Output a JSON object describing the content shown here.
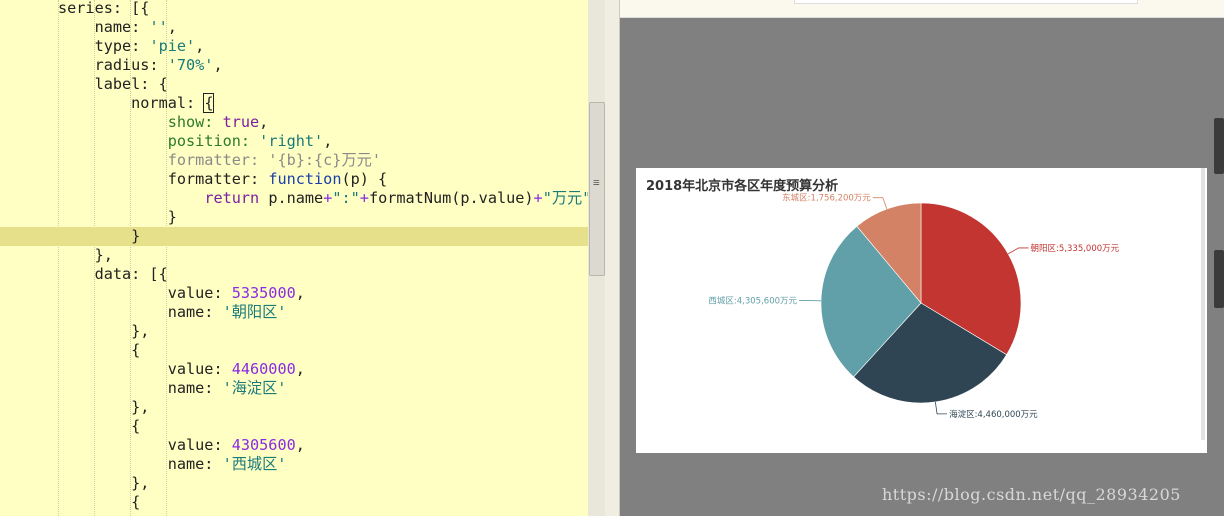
{
  "editor": {
    "lines": [
      [
        {
          "t": "series: [{",
          "c": "k"
        }
      ],
      [
        {
          "t": "    name: ",
          "c": "k"
        },
        {
          "t": "''",
          "c": "s"
        },
        {
          "t": ",",
          "c": "k"
        }
      ],
      [
        {
          "t": "    type: ",
          "c": "k"
        },
        {
          "t": "'pie'",
          "c": "s"
        },
        {
          "t": ",",
          "c": "k"
        }
      ],
      [
        {
          "t": "    radius: ",
          "c": "k"
        },
        {
          "t": "'70%'",
          "c": "s"
        },
        {
          "t": ",",
          "c": "k"
        }
      ],
      [
        {
          "t": "    label: {",
          "c": "k"
        }
      ],
      [
        {
          "t": "        normal: ",
          "c": "k"
        },
        {
          "t": "{",
          "c": "k cur"
        }
      ],
      [
        {
          "t": "            show: ",
          "c": "g"
        },
        {
          "t": "true",
          "c": "kw"
        },
        {
          "t": ",",
          "c": "k"
        }
      ],
      [
        {
          "t": "            position: ",
          "c": "g"
        },
        {
          "t": "'right'",
          "c": "s"
        },
        {
          "t": ",",
          "c": "k"
        }
      ],
      [
        {
          "t": "            formatter: '{b}:{c}万元'",
          "c": "cm"
        }
      ],
      [
        {
          "t": "            formatter: ",
          "c": "k"
        },
        {
          "t": "function",
          "c": "fn"
        },
        {
          "t": "(p) {",
          "c": "k"
        }
      ],
      [
        {
          "t": "                ",
          "c": "k"
        },
        {
          "t": "return",
          "c": "kw"
        },
        {
          "t": " p.name",
          "c": "k"
        },
        {
          "t": "+",
          "c": "op"
        },
        {
          "t": "\":\"",
          "c": "s"
        },
        {
          "t": "+",
          "c": "op"
        },
        {
          "t": "formatNum(p.value)",
          "c": "k"
        },
        {
          "t": "+",
          "c": "op"
        },
        {
          "t": "\"万元\"",
          "c": "s"
        },
        {
          "t": ";",
          "c": "k"
        }
      ],
      [
        {
          "t": "            }",
          "c": "k"
        }
      ],
      [
        {
          "t": "        }",
          "c": "k"
        }
      ],
      [
        {
          "t": "    },",
          "c": "k"
        }
      ],
      [
        {
          "t": "    data: [{",
          "c": "k"
        }
      ],
      [
        {
          "t": "            value: ",
          "c": "k"
        },
        {
          "t": "5335000",
          "c": "n"
        },
        {
          "t": ",",
          "c": "k"
        }
      ],
      [
        {
          "t": "            name: ",
          "c": "k"
        },
        {
          "t": "'朝阳区'",
          "c": "s"
        }
      ],
      [
        {
          "t": "        },",
          "c": "k"
        }
      ],
      [
        {
          "t": "        {",
          "c": "k"
        }
      ],
      [
        {
          "t": "            value: ",
          "c": "k"
        },
        {
          "t": "4460000",
          "c": "n"
        },
        {
          "t": ",",
          "c": "k"
        }
      ],
      [
        {
          "t": "            name: ",
          "c": "k"
        },
        {
          "t": "'海淀区'",
          "c": "s"
        }
      ],
      [
        {
          "t": "        },",
          "c": "k"
        }
      ],
      [
        {
          "t": "        {",
          "c": "k"
        }
      ],
      [
        {
          "t": "            value: ",
          "c": "k"
        },
        {
          "t": "4305600",
          "c": "n"
        },
        {
          "t": ",",
          "c": "k"
        }
      ],
      [
        {
          "t": "            name: ",
          "c": "k"
        },
        {
          "t": "'西城区'",
          "c": "s"
        }
      ],
      [
        {
          "t": "        },",
          "c": "k"
        }
      ],
      [
        {
          "t": "        {",
          "c": "k"
        }
      ],
      [
        {
          "t": "",
          "c": "k"
        }
      ]
    ],
    "active_line": 12
  },
  "preview": {
    "chart_title": "2018年北京市各区年度预算分析",
    "watermark": "https://blog.csdn.net/qq_28934205"
  },
  "chart_data": {
    "type": "pie",
    "title": "2018年北京市各区年度预算分析",
    "radius": "70%",
    "label_position": "right",
    "slices": [
      {
        "name": "朝阳区",
        "value": 5335000,
        "label": "朝阳区:5,335,000万元",
        "color": "#c23531"
      },
      {
        "name": "海淀区",
        "value": 4460000,
        "label": "海淀区:4,460,000万元",
        "color": "#2f4554"
      },
      {
        "name": "西城区",
        "value": 4305600,
        "label": "西城区:4,305,600万元",
        "color": "#61a0a8"
      },
      {
        "name": "东城区",
        "value": 1756200,
        "label": "东城区:1,756,200万元",
        "color": "#d48265"
      }
    ]
  }
}
